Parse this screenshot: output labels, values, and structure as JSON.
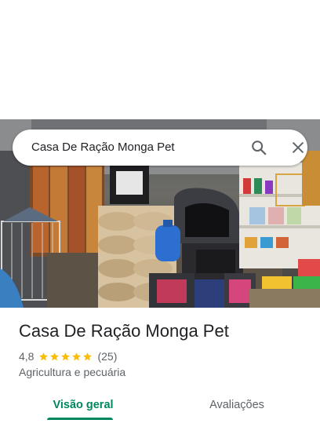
{
  "search": {
    "query": "Casa De Ração Monga Pet",
    "search_icon": "search-icon",
    "close_icon": "close-icon"
  },
  "place": {
    "name": "Casa De Ração Monga Pet",
    "rating": "4,8",
    "stars": 5,
    "review_count": "(25)",
    "category": "Agricultura e pecuária"
  },
  "tabs": [
    {
      "label": "Visão geral",
      "active": true
    },
    {
      "label": "Avaliações",
      "active": false
    }
  ],
  "colors": {
    "accent": "#01875f",
    "star": "#fbbc04",
    "text_primary": "#202124",
    "text_secondary": "#5f6368"
  }
}
